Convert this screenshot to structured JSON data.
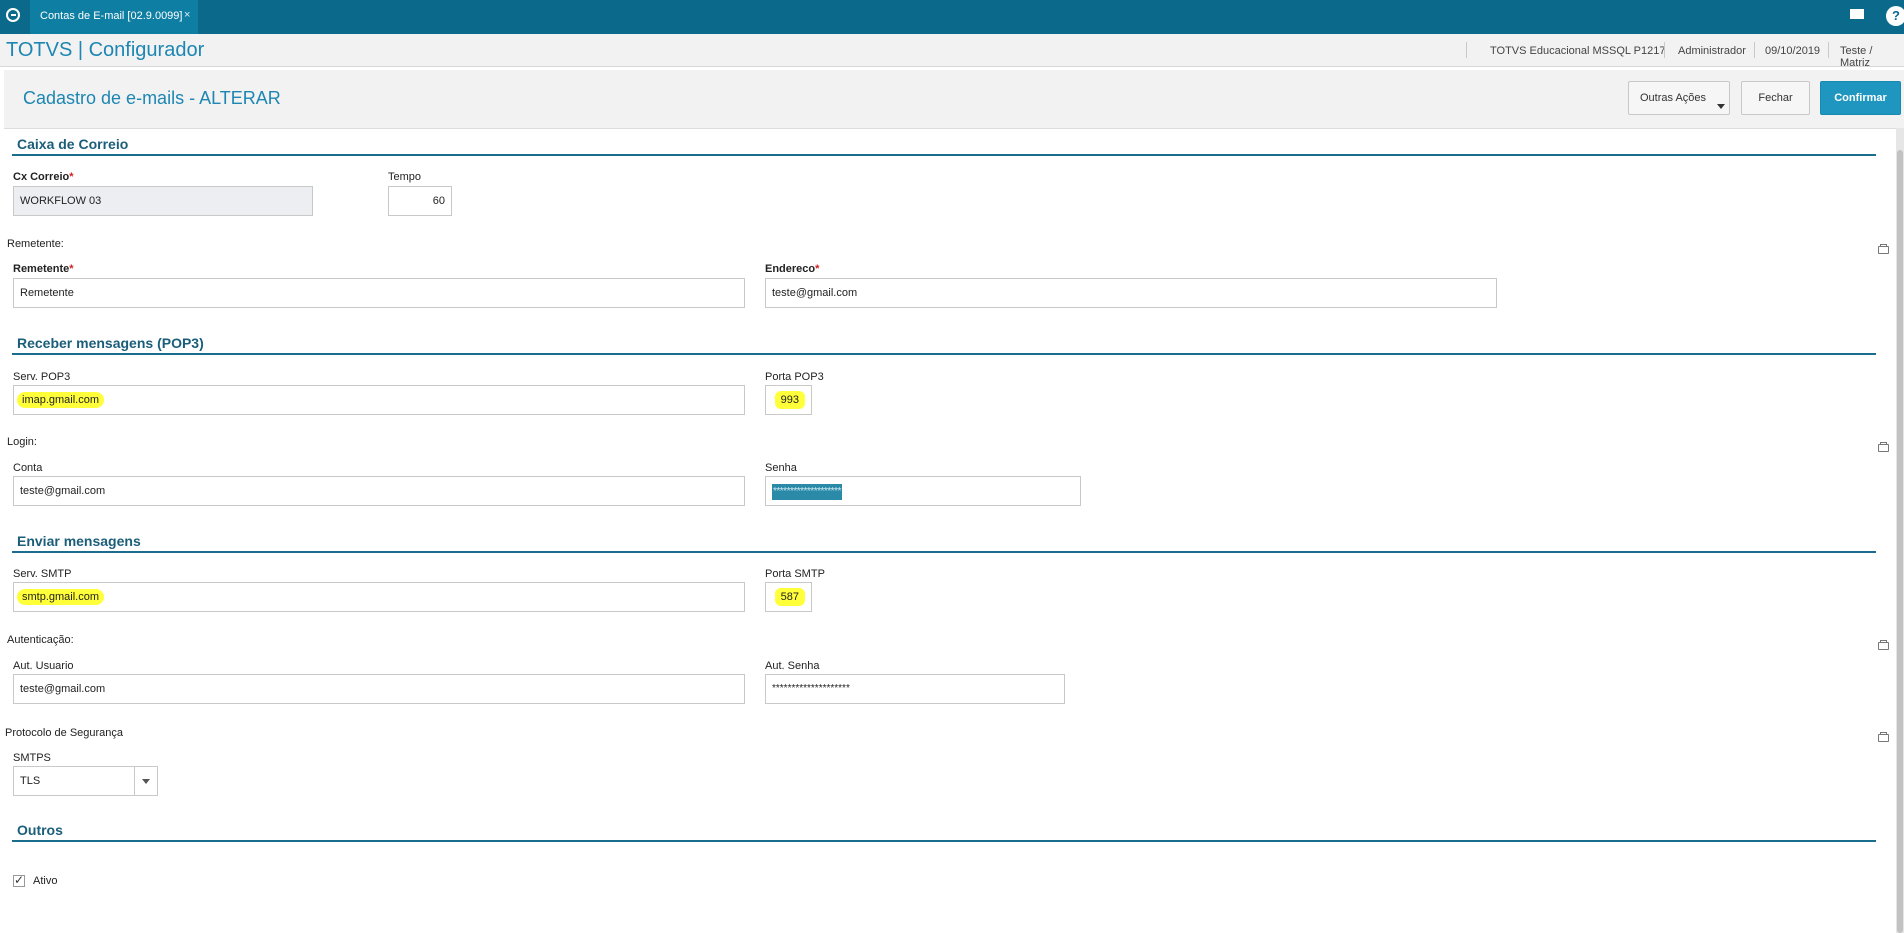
{
  "topbar": {
    "tab_label": "Contas de E-mail [02.9.0099]",
    "close_glyph": "×",
    "help_glyph": "?"
  },
  "header": {
    "app_title": "TOTVS | Configurador",
    "environment": "TOTVS Educacional MSSQL P1217",
    "user": "Administrador",
    "date": "09/10/2019",
    "company": "Teste / Matriz"
  },
  "page": {
    "title": "Cadastro de e-mails - ALTERAR",
    "buttons": {
      "other_actions": "Outras Ações",
      "close": "Fechar",
      "confirm": "Confirmar"
    }
  },
  "caixa": {
    "section_title": "Caixa de Correio",
    "cx_label": "Cx Correio",
    "cx_value": "WORKFLOW 03",
    "tempo_label": "Tempo",
    "tempo_value": "60"
  },
  "remetente": {
    "group_label": "Remetente:",
    "rem_label": "Remetente",
    "rem_value": "Remetente",
    "end_label": "Endereco",
    "end_value": "teste@gmail.com"
  },
  "pop3": {
    "section_title": "Receber mensagens (POP3)",
    "serv_label": "Serv. POP3",
    "serv_value": "imap.gmail.com",
    "porta_label": "Porta POP3",
    "porta_value": "993"
  },
  "login": {
    "group_label": "Login:",
    "conta_label": "Conta",
    "conta_value": "teste@gmail.com",
    "senha_label": "Senha",
    "senha_value": "********************"
  },
  "smtp": {
    "section_title": "Enviar mensagens",
    "serv_label": "Serv. SMTP",
    "serv_value": "smtp.gmail.com",
    "porta_label": "Porta SMTP",
    "porta_value": "587"
  },
  "auth": {
    "group_label": "Autenticação:",
    "user_label": "Aut. Usuario",
    "user_value": "teste@gmail.com",
    "senha_label": "Aut. Senha",
    "senha_value": "********************"
  },
  "protocolo": {
    "group_label": "Protocolo de Segurança",
    "smtps_label": "SMTPS",
    "smtps_value": "TLS"
  },
  "outros": {
    "section_title": "Outros",
    "ativo_label": "Ativo",
    "ativo_checked": true
  },
  "required_mark": "*",
  "check_glyph": "✓",
  "colors": {
    "accent": "#1d86b2",
    "topbar": "#0b6a8c",
    "highlight": "#ffff3a",
    "confirm": "#1e96c0"
  }
}
